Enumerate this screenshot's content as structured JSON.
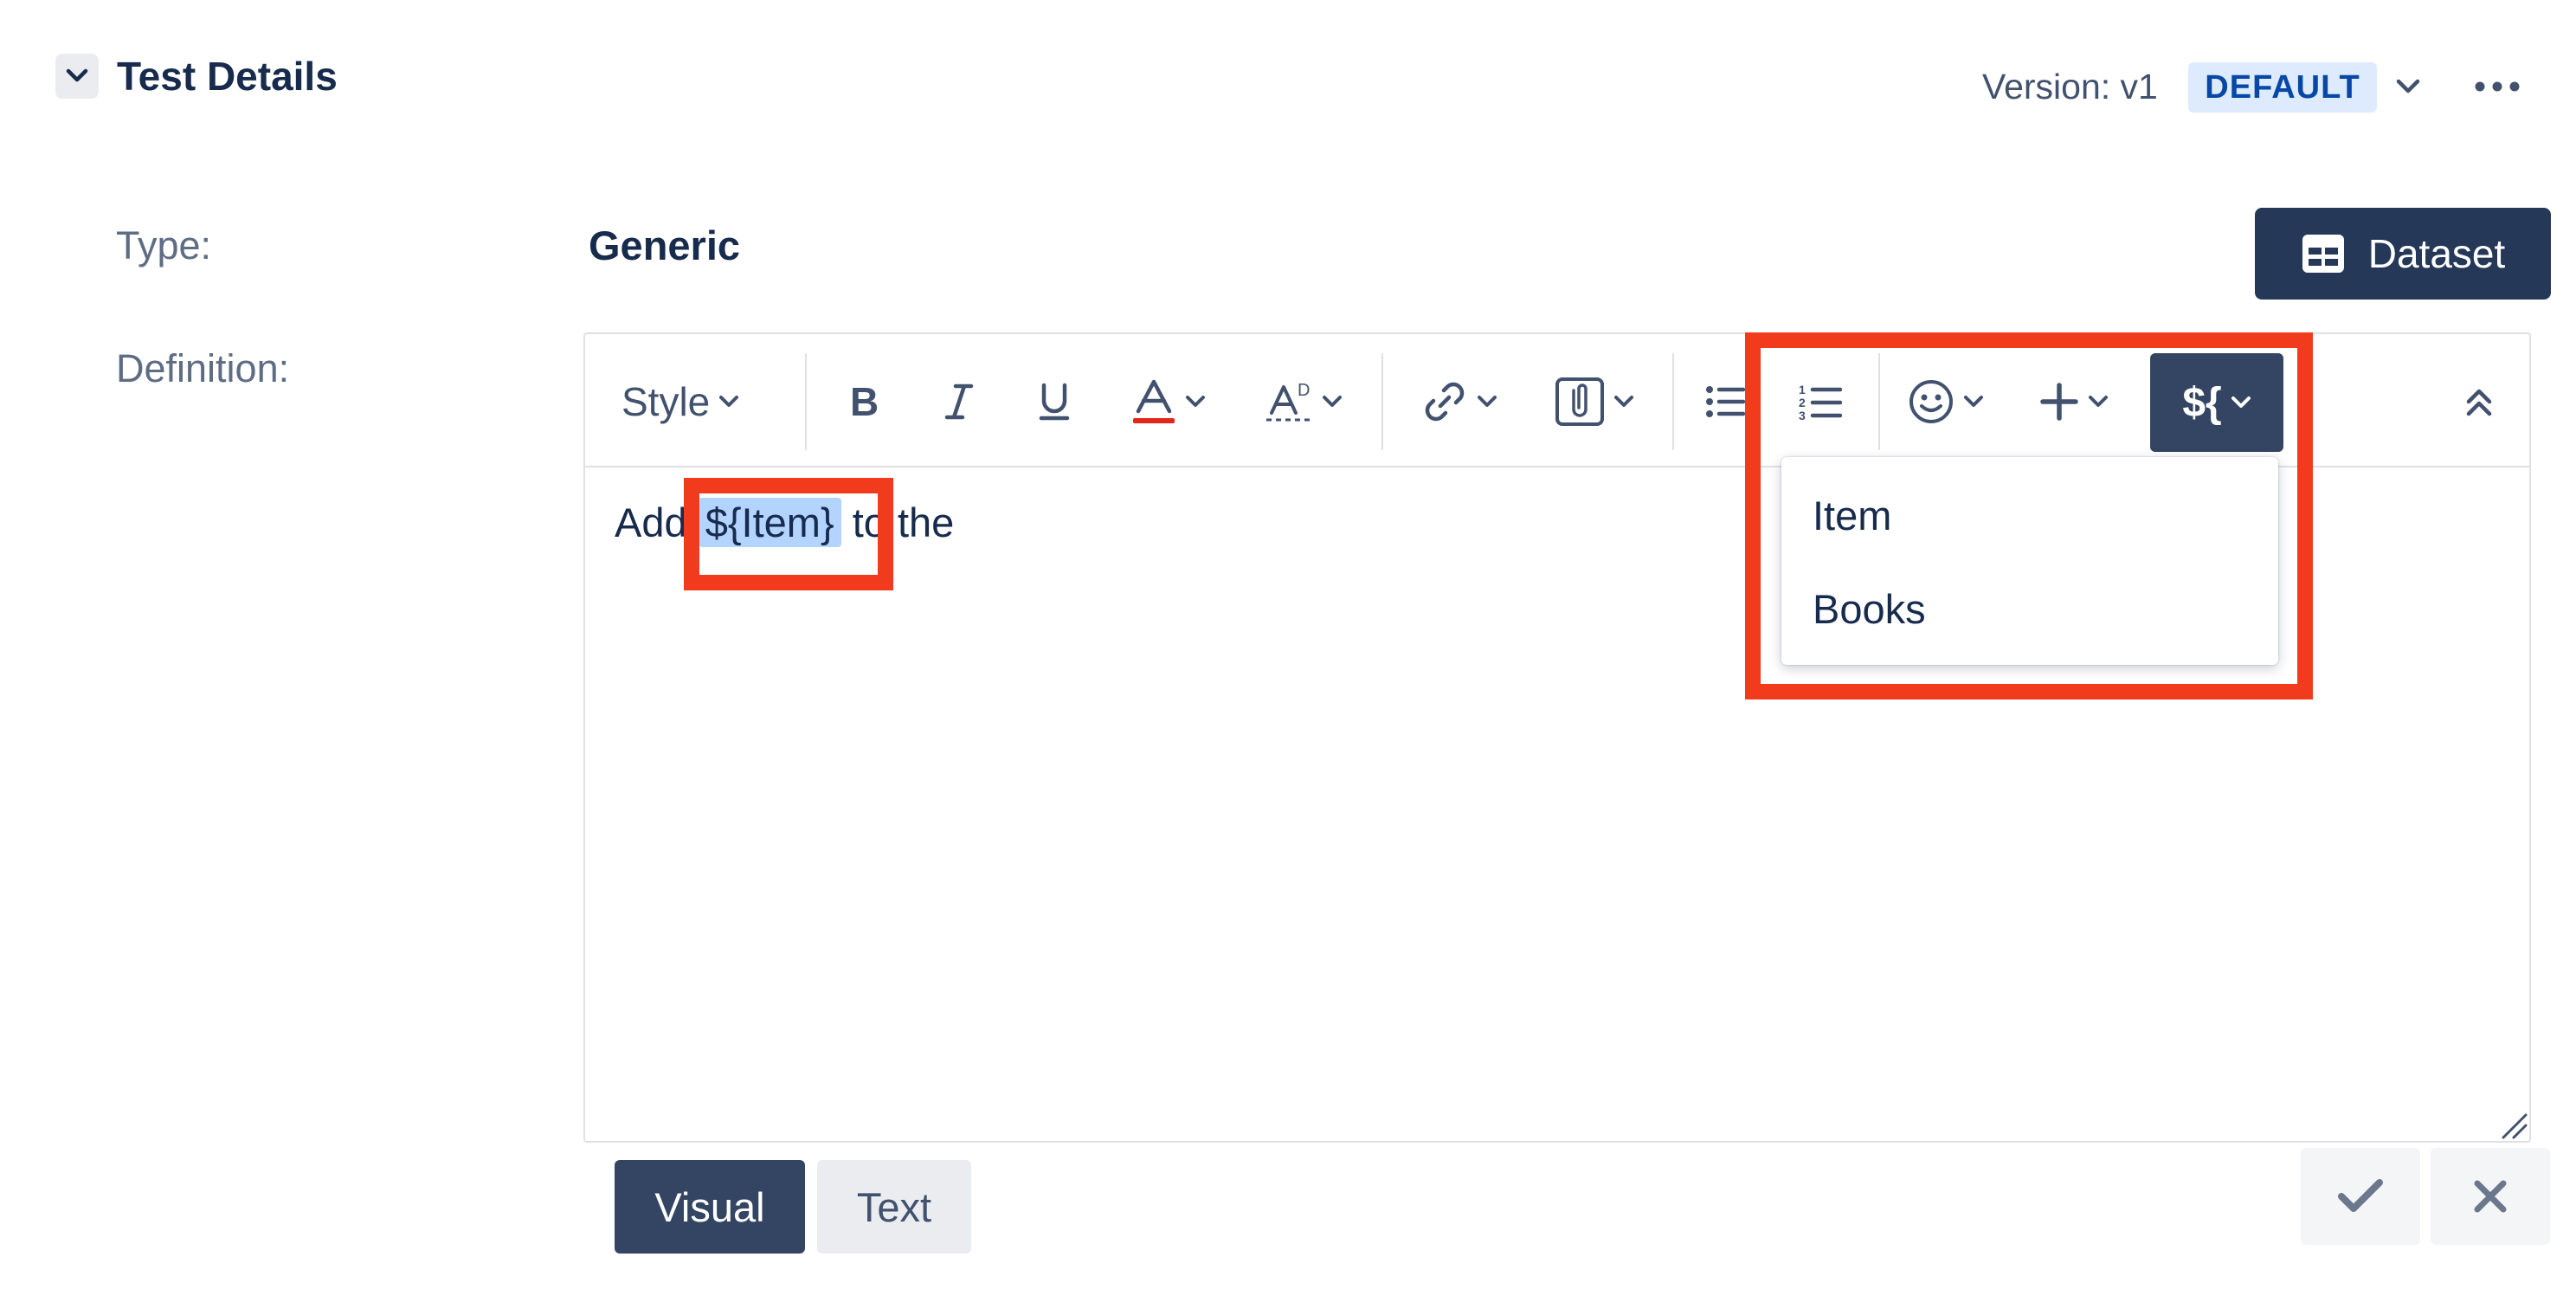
{
  "header": {
    "title": "Test Details",
    "version_label": "Version: v1",
    "version_badge": "DEFAULT"
  },
  "fields": {
    "type_label": "Type:",
    "type_value": "Generic",
    "definition_label": "Definition:"
  },
  "dataset_button": {
    "label": "Dataset"
  },
  "toolbar": {
    "style_label": "Style",
    "variable_label": "${"
  },
  "editor": {
    "text_before": "Add",
    "variable_chip": "${Item}",
    "text_after": "to the"
  },
  "variable_dropdown": {
    "items": [
      "Item",
      "Books"
    ]
  },
  "tabs": {
    "visual": "Visual",
    "text": "Text"
  },
  "colors": {
    "annotation_red": "#F23B1D",
    "primary_dark": "#344563",
    "badge_bg": "#DEEBFF",
    "chip_highlight": "#B3D4FF"
  }
}
